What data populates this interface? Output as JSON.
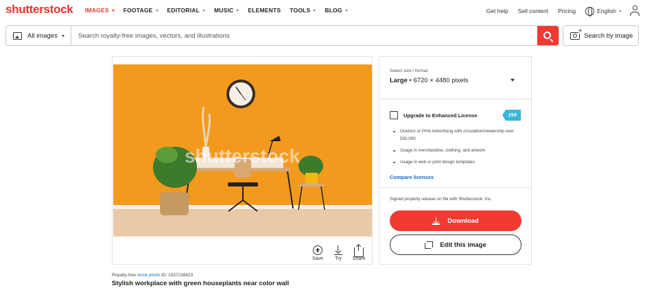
{
  "brand": {
    "logo_text": "shutterstock",
    "accent_color": "#e93428"
  },
  "nav": {
    "items": [
      {
        "label": "IMAGES",
        "active": true
      },
      {
        "label": "FOOTAGE"
      },
      {
        "label": "EDITORIAL"
      },
      {
        "label": "MUSIC"
      },
      {
        "label": "ELEMENTS"
      },
      {
        "label": "TOOLS"
      },
      {
        "label": "BLOG"
      }
    ],
    "right": {
      "help": "Get help",
      "sell": "Sell content",
      "pricing": "Pricing",
      "language": "English"
    }
  },
  "search": {
    "type_label": "All images",
    "placeholder": "Search royalty-free images, vectors, and illustrations",
    "by_image_label": "Search by image"
  },
  "image": {
    "actions": {
      "save": "Save",
      "try": "Try",
      "share": "Share"
    },
    "meta_prefix": "Royalty-free",
    "meta_link": "stock photo",
    "meta_id": "ID: 1537238423",
    "title": "Stylish workplace with green houseplants near color wall",
    "watermark": "shutterstock"
  },
  "purchase": {
    "size_label": "Select size / format",
    "size_name": "Large",
    "size_detail": " • 6720 × 4480 pixels",
    "upgrade_label": "Upgrade to Enhanced License",
    "upgrade_price": "£59",
    "benefits": [
      "Outdoor or Print Advertising with circulation/viewership over 500,000",
      "Usage in merchandise, clothing, and artwork",
      "Usage in web or print design templates"
    ],
    "compare_link": "Compare licenses",
    "release_note": "Signed property release on file with Shutterstock, Inc.",
    "download_label": "Download",
    "edit_label": "Edit this image",
    "download_color": "#f03a32",
    "badge_color": "#3bb7d8"
  }
}
